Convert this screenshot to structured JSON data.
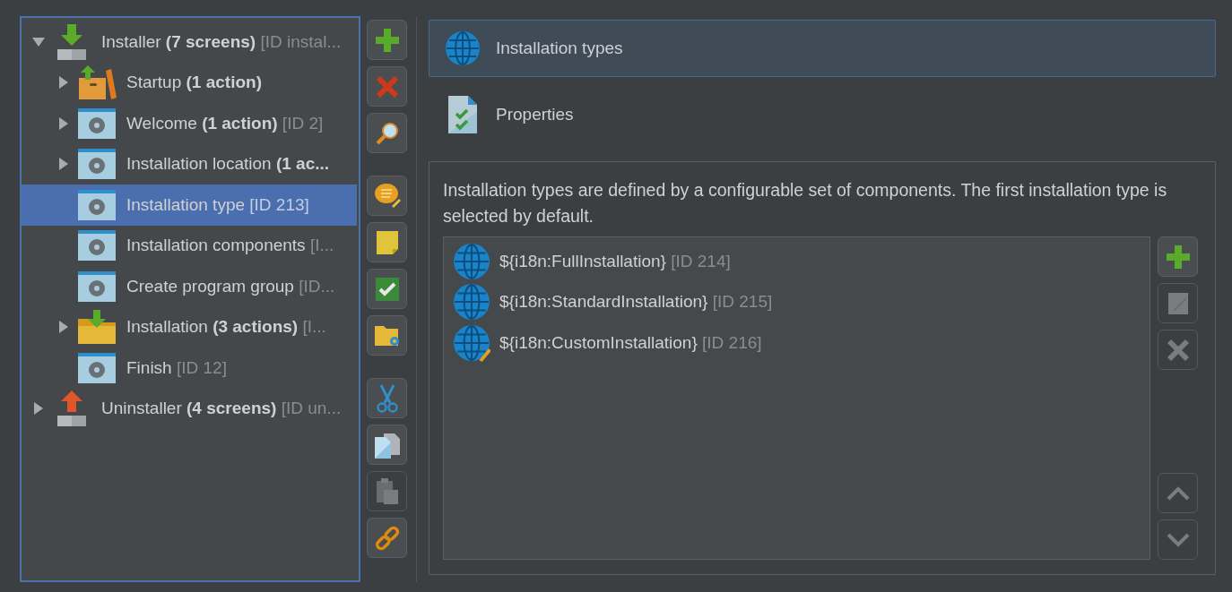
{
  "tree": [
    {
      "name": "Installer",
      "count": "(7 screens)",
      "id": "[ID instal...",
      "kind": "installer",
      "expanded": true,
      "selected": false,
      "children": [
        {
          "name": "Startup",
          "count": "(1 action)",
          "kind": "box",
          "expanded": false,
          "selected": false
        },
        {
          "name": "Welcome",
          "count": "(1 action)",
          "id": "[ID 2]",
          "kind": "screen",
          "expanded": false,
          "selected": false
        },
        {
          "name": "Installation location",
          "count": "(1 ac...",
          "kind": "screen",
          "expanded": false,
          "selected": false
        },
        {
          "name": "Installation type",
          "id": "[ID 213]",
          "kind": "screen",
          "selected": true
        },
        {
          "name": "Installation components",
          "id": "[I...",
          "kind": "screen",
          "selected": false
        },
        {
          "name": "Create program group",
          "id": "[ID...",
          "kind": "screen",
          "selected": false
        },
        {
          "name": "Installation",
          "count": "(3 actions)",
          "id": "[I...",
          "kind": "folder",
          "expanded": false,
          "selected": false
        },
        {
          "name": "Finish",
          "id": "[ID 12]",
          "kind": "screen",
          "selected": false
        }
      ]
    },
    {
      "name": "Uninstaller",
      "count": "(4 screens)",
      "id": "[ID un...",
      "kind": "uninstaller",
      "expanded": false,
      "selected": false
    }
  ],
  "toolbar": [
    [
      {
        "kind": "plus",
        "disabled": false
      },
      {
        "kind": "cross",
        "disabled": false
      },
      {
        "kind": "search",
        "disabled": false
      }
    ],
    [
      {
        "kind": "comment",
        "disabled": false
      },
      {
        "kind": "note",
        "disabled": false
      },
      {
        "kind": "check",
        "disabled": false
      },
      {
        "kind": "folder",
        "disabled": false
      }
    ],
    [
      {
        "kind": "scissors",
        "disabled": false
      },
      {
        "kind": "copy",
        "disabled": false
      },
      {
        "kind": "paste",
        "disabled": true
      },
      {
        "kind": "link",
        "disabled": false
      }
    ]
  ],
  "sections": [
    {
      "label": "Installation types",
      "kind": "globe",
      "selected": true
    },
    {
      "label": "Properties",
      "kind": "checklist",
      "selected": false
    }
  ],
  "description": "Installation types are defined by a configurable set of components. The first installation type is selected by default.",
  "types": [
    {
      "name": "${i18n:FullInstallation}",
      "id": "[ID 214]",
      "kind": "globe"
    },
    {
      "name": "${i18n:StandardInstallation}",
      "id": "[ID 215]",
      "kind": "globe"
    },
    {
      "name": "${i18n:CustomInstallation}",
      "id": "[ID 216]",
      "kind": "edit"
    }
  ],
  "list_buttons": [
    {
      "kind": "plus",
      "disabled": false
    },
    {
      "kind": "edit",
      "disabled": true
    },
    {
      "kind": "cross",
      "disabled": true
    },
    {
      "kind": "up",
      "disabled": true
    },
    {
      "kind": "down",
      "disabled": true
    }
  ]
}
